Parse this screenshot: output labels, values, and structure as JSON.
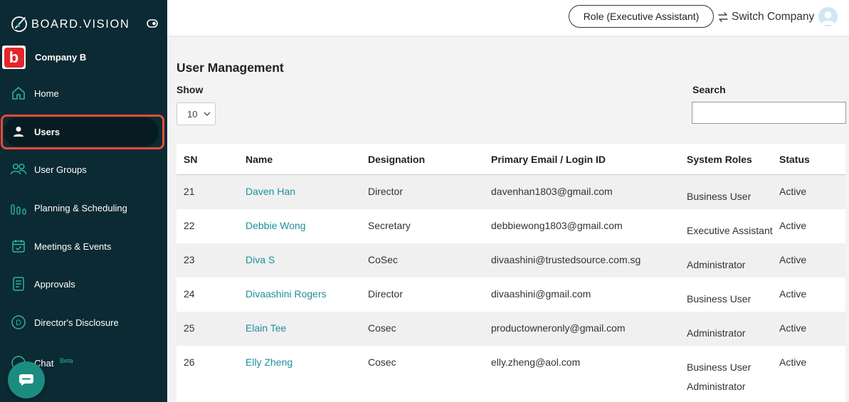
{
  "brand": {
    "name": "BOARD.VISION"
  },
  "company": {
    "name": "Company B",
    "logo_letter": "b"
  },
  "sidebar": {
    "items": [
      {
        "label": "Home",
        "icon": "home-icon"
      },
      {
        "label": "Users",
        "icon": "user-icon"
      },
      {
        "label": "User Groups",
        "icon": "users-icon"
      },
      {
        "label": "Planning & Scheduling",
        "icon": "bar-chart-icon"
      },
      {
        "label": "Meetings & Events",
        "icon": "calendar-check-icon"
      },
      {
        "label": "Approvals",
        "icon": "document-icon"
      },
      {
        "label": "Director's Disclosure",
        "icon": "circle-d-icon"
      },
      {
        "label": "Chat",
        "icon": "chat-icon",
        "badge": "Beta"
      }
    ],
    "active": "Users"
  },
  "topbar": {
    "role_label": "Role (Executive Assistant)",
    "switch_label": "Switch Company"
  },
  "page": {
    "title": "User Management",
    "show_label": "Show",
    "show_value": "10",
    "search_label": "Search",
    "search_value": ""
  },
  "table": {
    "columns": [
      "SN",
      "Name",
      "Designation",
      "Primary Email / Login ID",
      "System Roles",
      "Status"
    ],
    "rows": [
      {
        "sn": "21",
        "name": "Daven Han",
        "designation": "Director",
        "email": "davenhan1803@gmail.com",
        "roles": [
          "Business User"
        ],
        "status": "Active"
      },
      {
        "sn": "22",
        "name": "Debbie Wong",
        "designation": "Secretary",
        "email": "debbiewong1803@gmail.com",
        "roles": [
          "Executive Assistant"
        ],
        "status": "Active"
      },
      {
        "sn": "23",
        "name": "Diva S",
        "designation": "CoSec",
        "email": "divaashini@trustedsource.com.sg",
        "roles": [
          "Administrator"
        ],
        "status": "Active"
      },
      {
        "sn": "24",
        "name": "Divaashini Rogers",
        "designation": "Director",
        "email": "divaashini@gmail.com",
        "roles": [
          "Business User"
        ],
        "status": "Active"
      },
      {
        "sn": "25",
        "name": "Elain Tee",
        "designation": "Cosec",
        "email": "productowneronly@gmail.com",
        "roles": [
          "Administrator"
        ],
        "status": "Active"
      },
      {
        "sn": "26",
        "name": "Elly Zheng",
        "designation": "Cosec",
        "email": "elly.zheng@aol.com",
        "roles": [
          "Business User",
          "Administrator"
        ],
        "status": "Active"
      }
    ]
  },
  "colors": {
    "sidebar_bg": "#0c2a33",
    "accent": "#1f8f9a",
    "highlight": "#e14d3c"
  }
}
